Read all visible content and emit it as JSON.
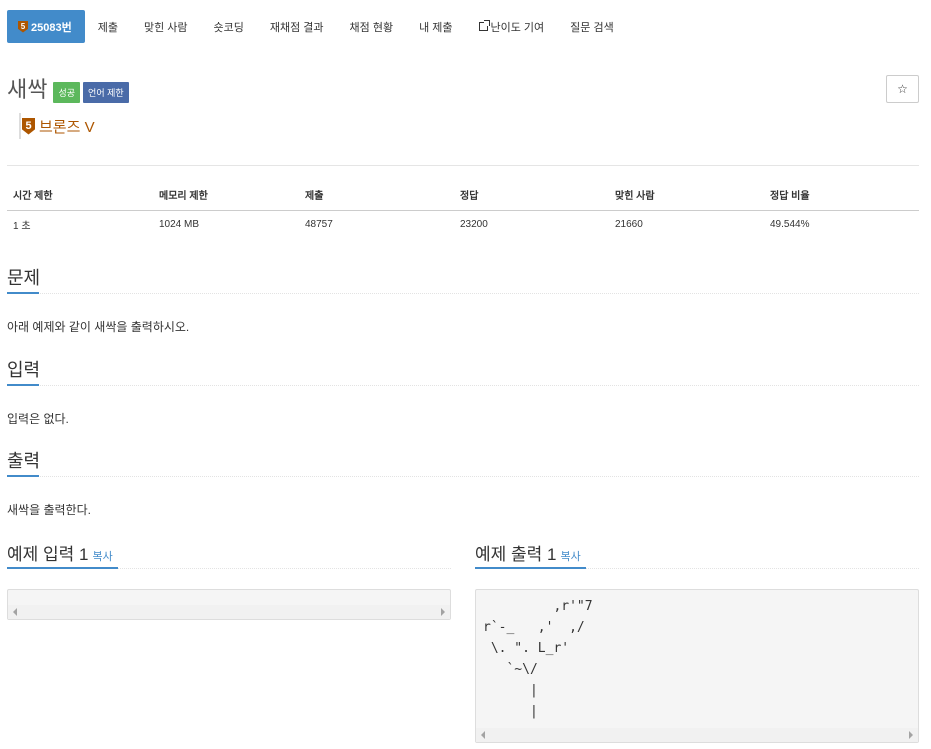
{
  "tabs": [
    {
      "label": "25083번",
      "tier_num": "5",
      "active": true
    },
    {
      "label": "제출"
    },
    {
      "label": "맞힌 사람"
    },
    {
      "label": "숏코딩"
    },
    {
      "label": "재채점 결과"
    },
    {
      "label": "채점 현황"
    },
    {
      "label": "내 제출"
    },
    {
      "label": "난이도 기여",
      "icon": "external-link-icon"
    },
    {
      "label": "질문 검색"
    }
  ],
  "problem": {
    "title": "새싹",
    "badges": [
      "성공",
      "언어 제한"
    ],
    "tier_num": "5",
    "tier_label": "브론즈 V",
    "star_icon": "☆"
  },
  "info": {
    "headers": [
      "시간 제한",
      "메모리 제한",
      "제출",
      "정답",
      "맞힌 사람",
      "정답 비율"
    ],
    "values": [
      "1 초",
      "1024 MB",
      "48757",
      "23200",
      "21660",
      "49.544%"
    ]
  },
  "sections": {
    "problem_title": "문제",
    "problem_text": "아래 예제와 같이 새싹을 출력하시오.",
    "input_title": "입력",
    "input_text": "입력은 없다.",
    "output_title": "출력",
    "output_text": "새싹을 출력한다."
  },
  "samples": {
    "input_title": "예제 입력 1",
    "output_title": "예제 출력 1",
    "copy_label": "복사",
    "input_text": "",
    "output_text": "         ,r'\"7\nr`-_   ,'  ,/\n \\. \". L_r'\n   `~\\/\n      |\n      |"
  },
  "colors": {
    "primary": "#428bca",
    "success": "#5cb85c",
    "bronze": "#ad5600"
  }
}
